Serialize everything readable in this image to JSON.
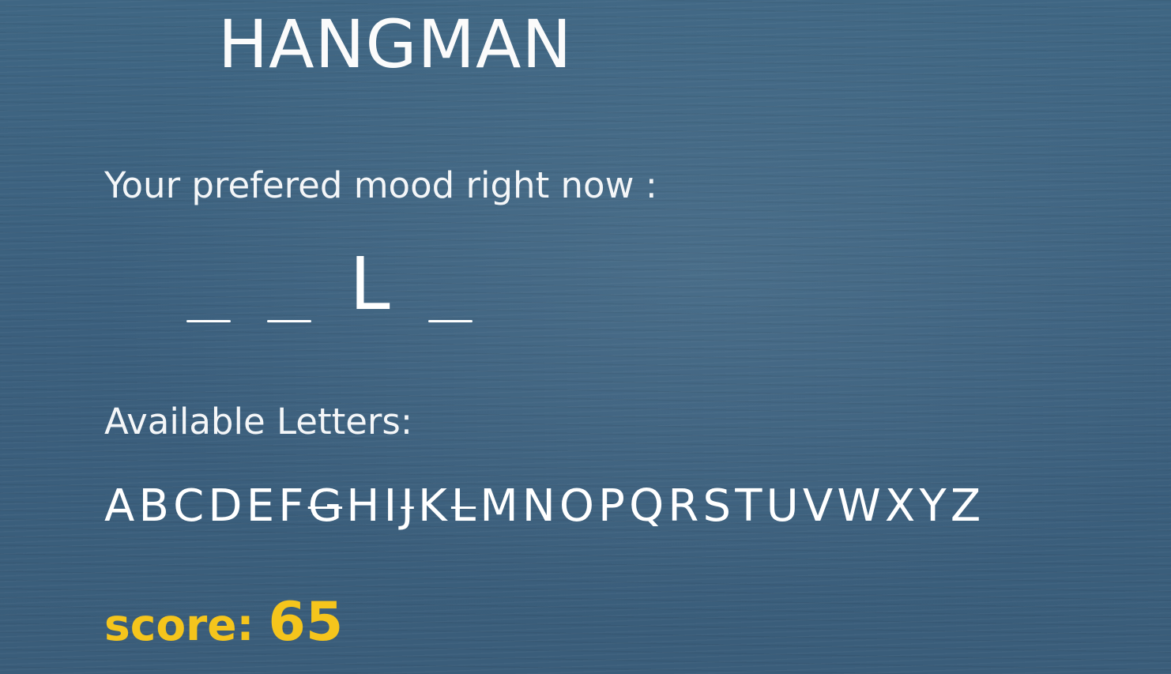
{
  "game": {
    "title": "HANGMAN",
    "prompt": "Your prefered mood right now :",
    "word_slots": [
      {
        "letter": "",
        "revealed": false
      },
      {
        "letter": "",
        "revealed": false
      },
      {
        "letter": "L",
        "revealed": true
      },
      {
        "letter": "",
        "revealed": false
      }
    ],
    "available_label": "Available Letters:",
    "letters": [
      {
        "char": "A",
        "used": false
      },
      {
        "char": "B",
        "used": false
      },
      {
        "char": "C",
        "used": false
      },
      {
        "char": "D",
        "used": false
      },
      {
        "char": "E",
        "used": false
      },
      {
        "char": "F",
        "used": false
      },
      {
        "char": "G",
        "used": true
      },
      {
        "char": "H",
        "used": false
      },
      {
        "char": "I",
        "used": false
      },
      {
        "char": "J",
        "used": true
      },
      {
        "char": "K",
        "used": false
      },
      {
        "char": "L",
        "used": true
      },
      {
        "char": "M",
        "used": false
      },
      {
        "char": "N",
        "used": false
      },
      {
        "char": "O",
        "used": false
      },
      {
        "char": "P",
        "used": false
      },
      {
        "char": "Q",
        "used": false
      },
      {
        "char": "R",
        "used": false
      },
      {
        "char": "S",
        "used": false
      },
      {
        "char": "T",
        "used": false
      },
      {
        "char": "U",
        "used": false
      },
      {
        "char": "V",
        "used": false
      },
      {
        "char": "W",
        "used": false
      },
      {
        "char": "X",
        "used": false
      },
      {
        "char": "Y",
        "used": false
      },
      {
        "char": "Z",
        "used": false
      }
    ],
    "score_label": "score:",
    "score_value": "65"
  },
  "colors": {
    "background": "#3e6280",
    "text": "#ffffff",
    "score": "#f5c51c"
  }
}
